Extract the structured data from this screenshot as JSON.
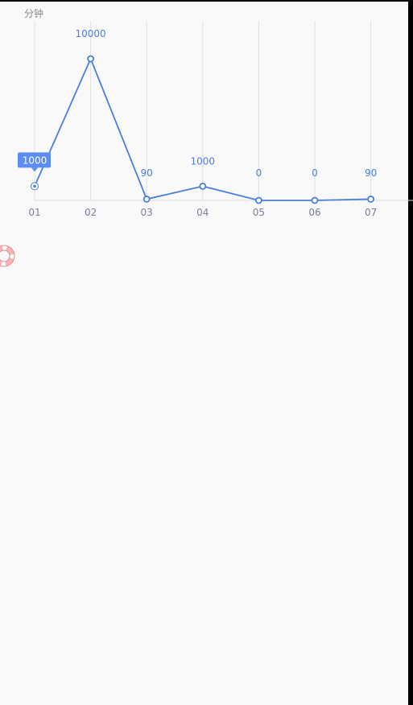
{
  "chart_data": {
    "type": "line",
    "unit_label": "分钟",
    "categories": [
      "01",
      "02",
      "03",
      "04",
      "05",
      "06",
      "07"
    ],
    "values": [
      1000,
      10000,
      90,
      1000,
      0,
      0,
      90
    ],
    "value_labels": [
      "1000",
      "10000",
      "90",
      "1000",
      "0",
      "0",
      "90"
    ],
    "ylim": [
      0,
      10000
    ],
    "grid": "vertical",
    "highlight_index": 0,
    "tooltip": "1000",
    "series_color": "#4a7fe0"
  },
  "icons": {
    "floating_badge": "lifebuoy-icon"
  }
}
